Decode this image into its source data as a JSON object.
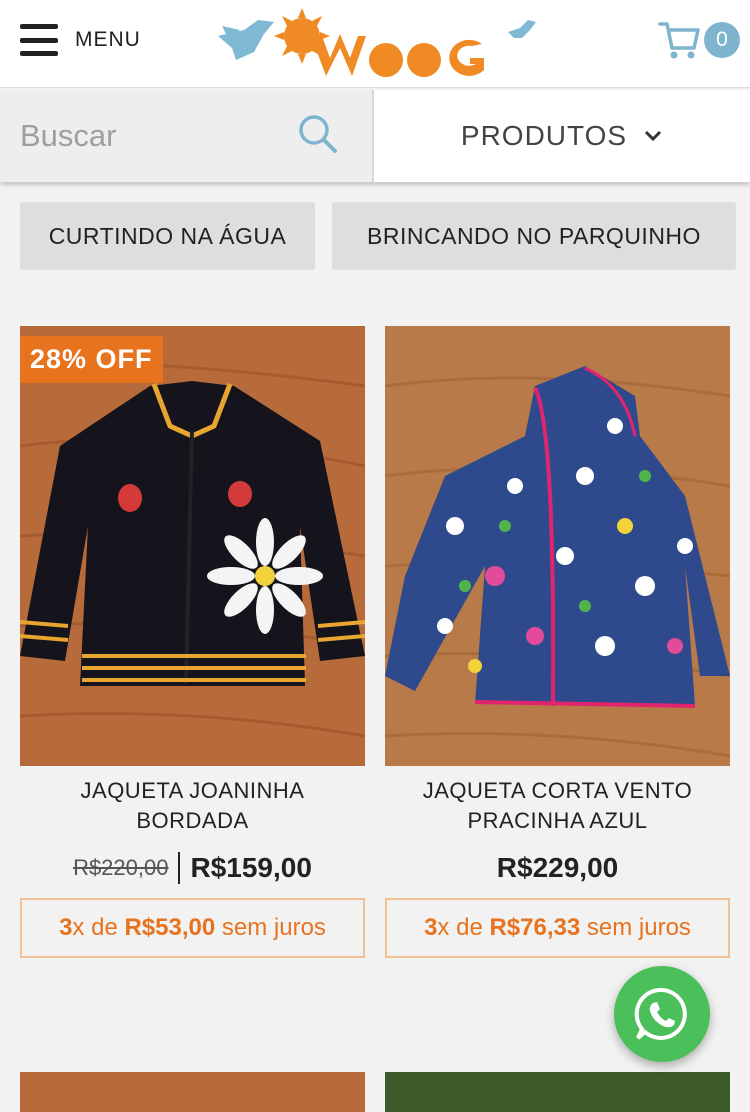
{
  "header": {
    "menu_label": "MENU",
    "logo_text": "wooc",
    "cart_count": "0"
  },
  "search": {
    "placeholder": "Buscar",
    "products_label": "PRODUTOS"
  },
  "categories": [
    {
      "label": "CURTINDO NA ÁGUA"
    },
    {
      "label": "BRINCANDO NO PARQUINHO"
    }
  ],
  "products": [
    {
      "badge": "28% OFF",
      "title_line1": "JAQUETA JOANINHA",
      "title_line2": "BORDADA",
      "old_price": "R$220,00",
      "price": "R$159,00",
      "installments": {
        "count": "3",
        "x_de": "x de",
        "amount": "R$53,00",
        "suffix": "sem juros"
      }
    },
    {
      "title_line1": "JAQUETA CORTA VENTO",
      "title_line2": "PRACINHA AZUL",
      "price": "R$229,00",
      "installments": {
        "count": "3",
        "x_de": "x de",
        "amount": "R$76,33",
        "suffix": "sem juros"
      }
    }
  ],
  "colors": {
    "accent": "#e8731f",
    "cart_badge": "#7fb4cf",
    "whatsapp": "#4bc05a"
  }
}
